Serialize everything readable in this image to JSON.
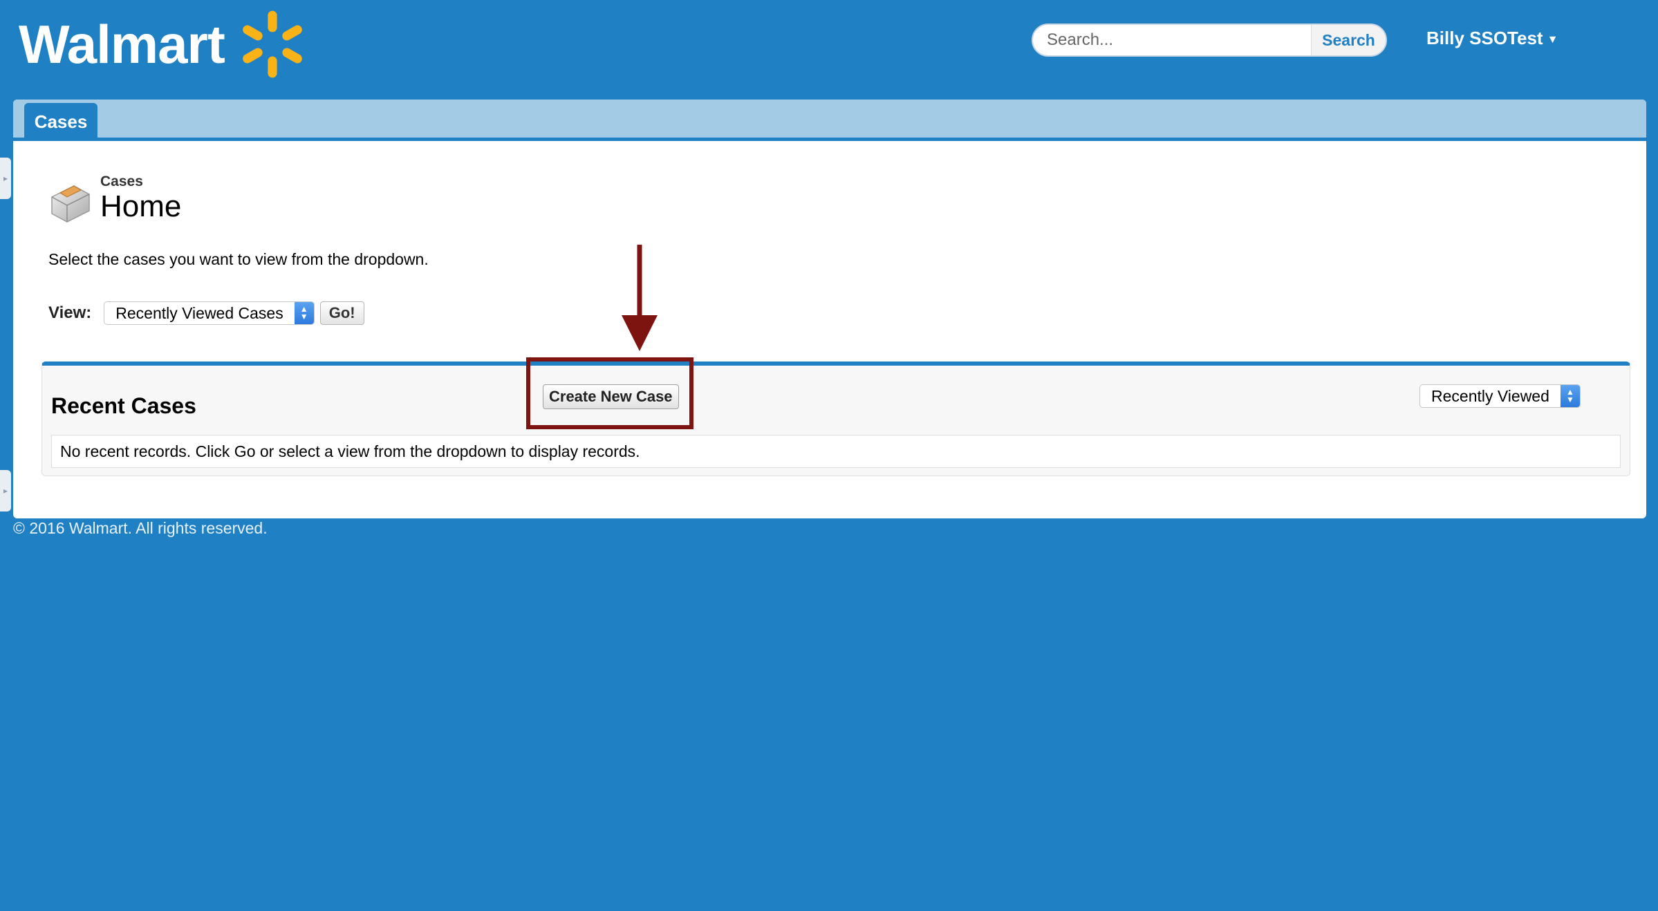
{
  "header": {
    "logo_text": "Walmart",
    "search_placeholder": "Search...",
    "search_button": "Search",
    "user_name": "Billy SSOTest"
  },
  "tabs": [
    {
      "label": "Cases",
      "active": true
    }
  ],
  "page": {
    "crumb": "Cases",
    "title": "Home",
    "intro": "Select the cases you want to view from the dropdown."
  },
  "view": {
    "label": "View:",
    "selected": "Recently Viewed Cases",
    "go_label": "Go!"
  },
  "recent": {
    "title": "Recent Cases",
    "create_button": "Create New Case",
    "filter_selected": "Recently Viewed",
    "empty_message": "No recent records. Click Go or select a view from the dropdown to display records."
  },
  "footer": {
    "copyright": "© 2016 Walmart. All rights reserved."
  },
  "colors": {
    "background": "#1f80c4",
    "tabbar": "#a3cbe6",
    "annotation": "#7d1410",
    "spark": "#f9b317"
  }
}
